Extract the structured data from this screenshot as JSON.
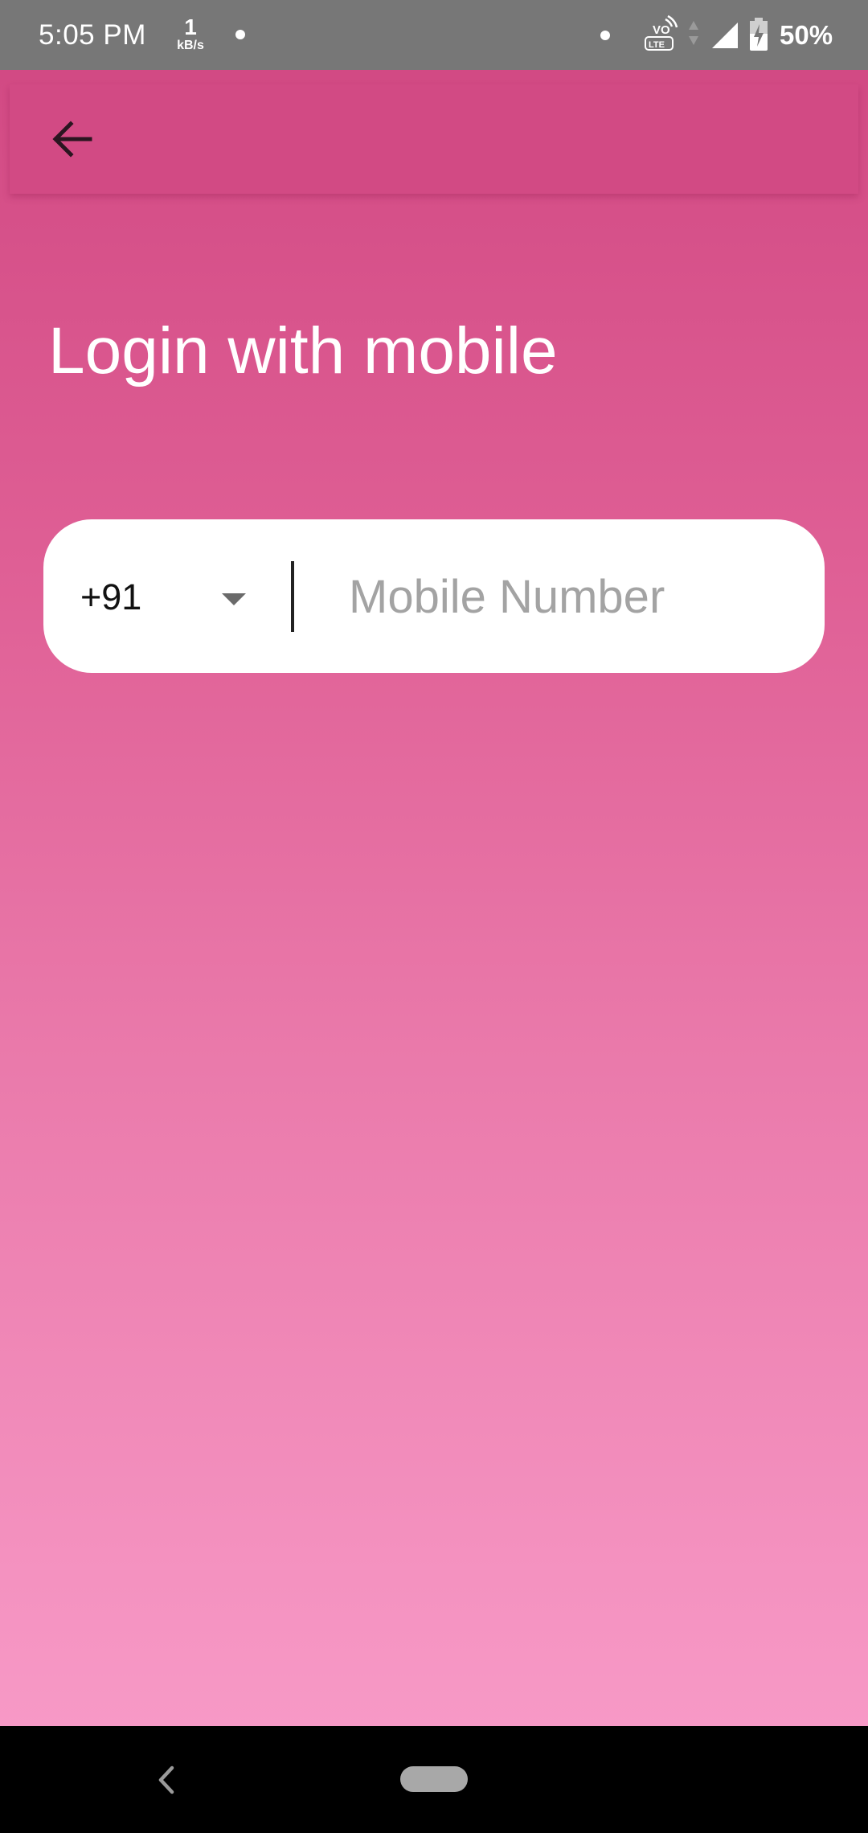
{
  "status_bar": {
    "time": "5:05 PM",
    "net_speed_value": "1",
    "net_speed_unit": "kB/s",
    "volte_label_top": "VO",
    "volte_label_bottom": "LTE",
    "battery_percent": "50%"
  },
  "toolbar": {
    "back_icon": "arrow-left-icon"
  },
  "page": {
    "title": "Login with mobile"
  },
  "phone_form": {
    "country_code": "+91",
    "dropdown_icon": "triangle-down-icon",
    "mobile_value": "",
    "mobile_placeholder": "Mobile Number"
  },
  "nav_bar": {
    "back_icon": "chevron-left-icon",
    "home_icon": "home-pill-icon"
  },
  "colors": {
    "status_bar": "#777777",
    "toolbar": "#d24a84",
    "background_top": "#d24a84",
    "background_bottom": "#f799c6",
    "card": "#ffffff",
    "placeholder": "#a3a3a3"
  }
}
